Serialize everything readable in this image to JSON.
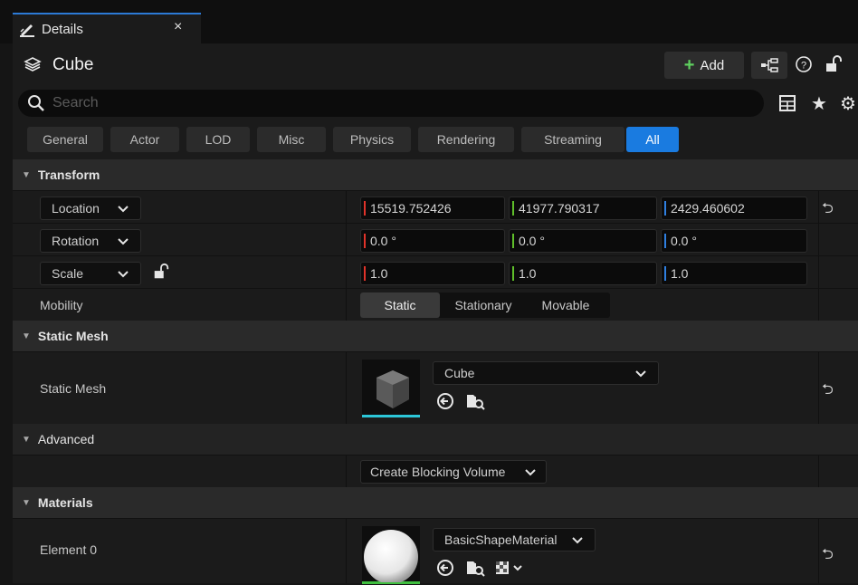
{
  "tab": {
    "label": "Details",
    "close": "×"
  },
  "header": {
    "title": "Cube",
    "add_label": "Add",
    "help": "?"
  },
  "search": {
    "placeholder": "Search"
  },
  "categories": [
    "General",
    "Actor",
    "LOD",
    "Misc",
    "Physics",
    "Rendering",
    "Streaming",
    "All"
  ],
  "active_category": "All",
  "transform": {
    "title": "Transform",
    "location_label": "Location",
    "location": [
      "15519.752426",
      "41977.790317",
      "2429.460602"
    ],
    "rotation_label": "Rotation",
    "rotation": [
      "0.0 °",
      "0.0 °",
      "0.0 °"
    ],
    "scale_label": "Scale",
    "scale": [
      "1.0",
      "1.0",
      "1.0"
    ],
    "mobility_label": "Mobility",
    "mobility_options": [
      "Static",
      "Stationary",
      "Movable"
    ],
    "mobility_selected": "Static"
  },
  "static_mesh": {
    "title": "Static Mesh",
    "label": "Static Mesh",
    "value": "Cube"
  },
  "advanced": {
    "title": "Advanced",
    "button": "Create Blocking Volume"
  },
  "materials": {
    "title": "Materials",
    "element_label": "Element 0",
    "value": "BasicShapeMaterial"
  },
  "axis_colors": {
    "x": "#e0332a",
    "y": "#5fbf2a",
    "z": "#2f7fe0"
  },
  "accent": "#1a7be0"
}
